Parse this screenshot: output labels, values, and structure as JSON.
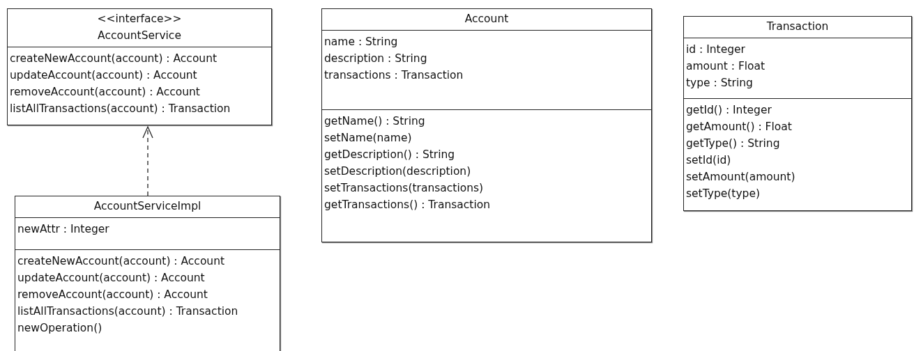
{
  "classes": [
    {
      "stereotype": "<<interface>>",
      "name": "AccountService",
      "operations": [
        "createNewAccount(account) : Account",
        "updateAccount(account) : Account",
        "removeAccount(account) : Account",
        "listAllTransactions(account) : Transaction"
      ]
    },
    {
      "name": "AccountServiceImpl",
      "attributes": [
        "newAttr : Integer"
      ],
      "operations": [
        "createNewAccount(account) : Account",
        "updateAccount(account) : Account",
        "removeAccount(account) : Account",
        "listAllTransactions(account) : Transaction",
        "newOperation()"
      ]
    },
    {
      "name": "Account",
      "attributes": [
        "name : String",
        "description : String",
        "transactions : Transaction"
      ],
      "operations": [
        "getName() : String",
        "setName(name)",
        "getDescription() : String",
        "setDescription(description)",
        "setTransactions(transactions)",
        "getTransactions() : Transaction"
      ]
    },
    {
      "name": "Transaction",
      "attributes": [
        "id : Integer",
        "amount : Float",
        "type : String"
      ],
      "operations": [
        "getId() : Integer",
        "getAmount() : Float",
        "getType() : String",
        "setId(id)",
        "setAmount(amount)",
        "setType(type)"
      ]
    }
  ],
  "relations": [
    {
      "kind": "realization"
    }
  ]
}
